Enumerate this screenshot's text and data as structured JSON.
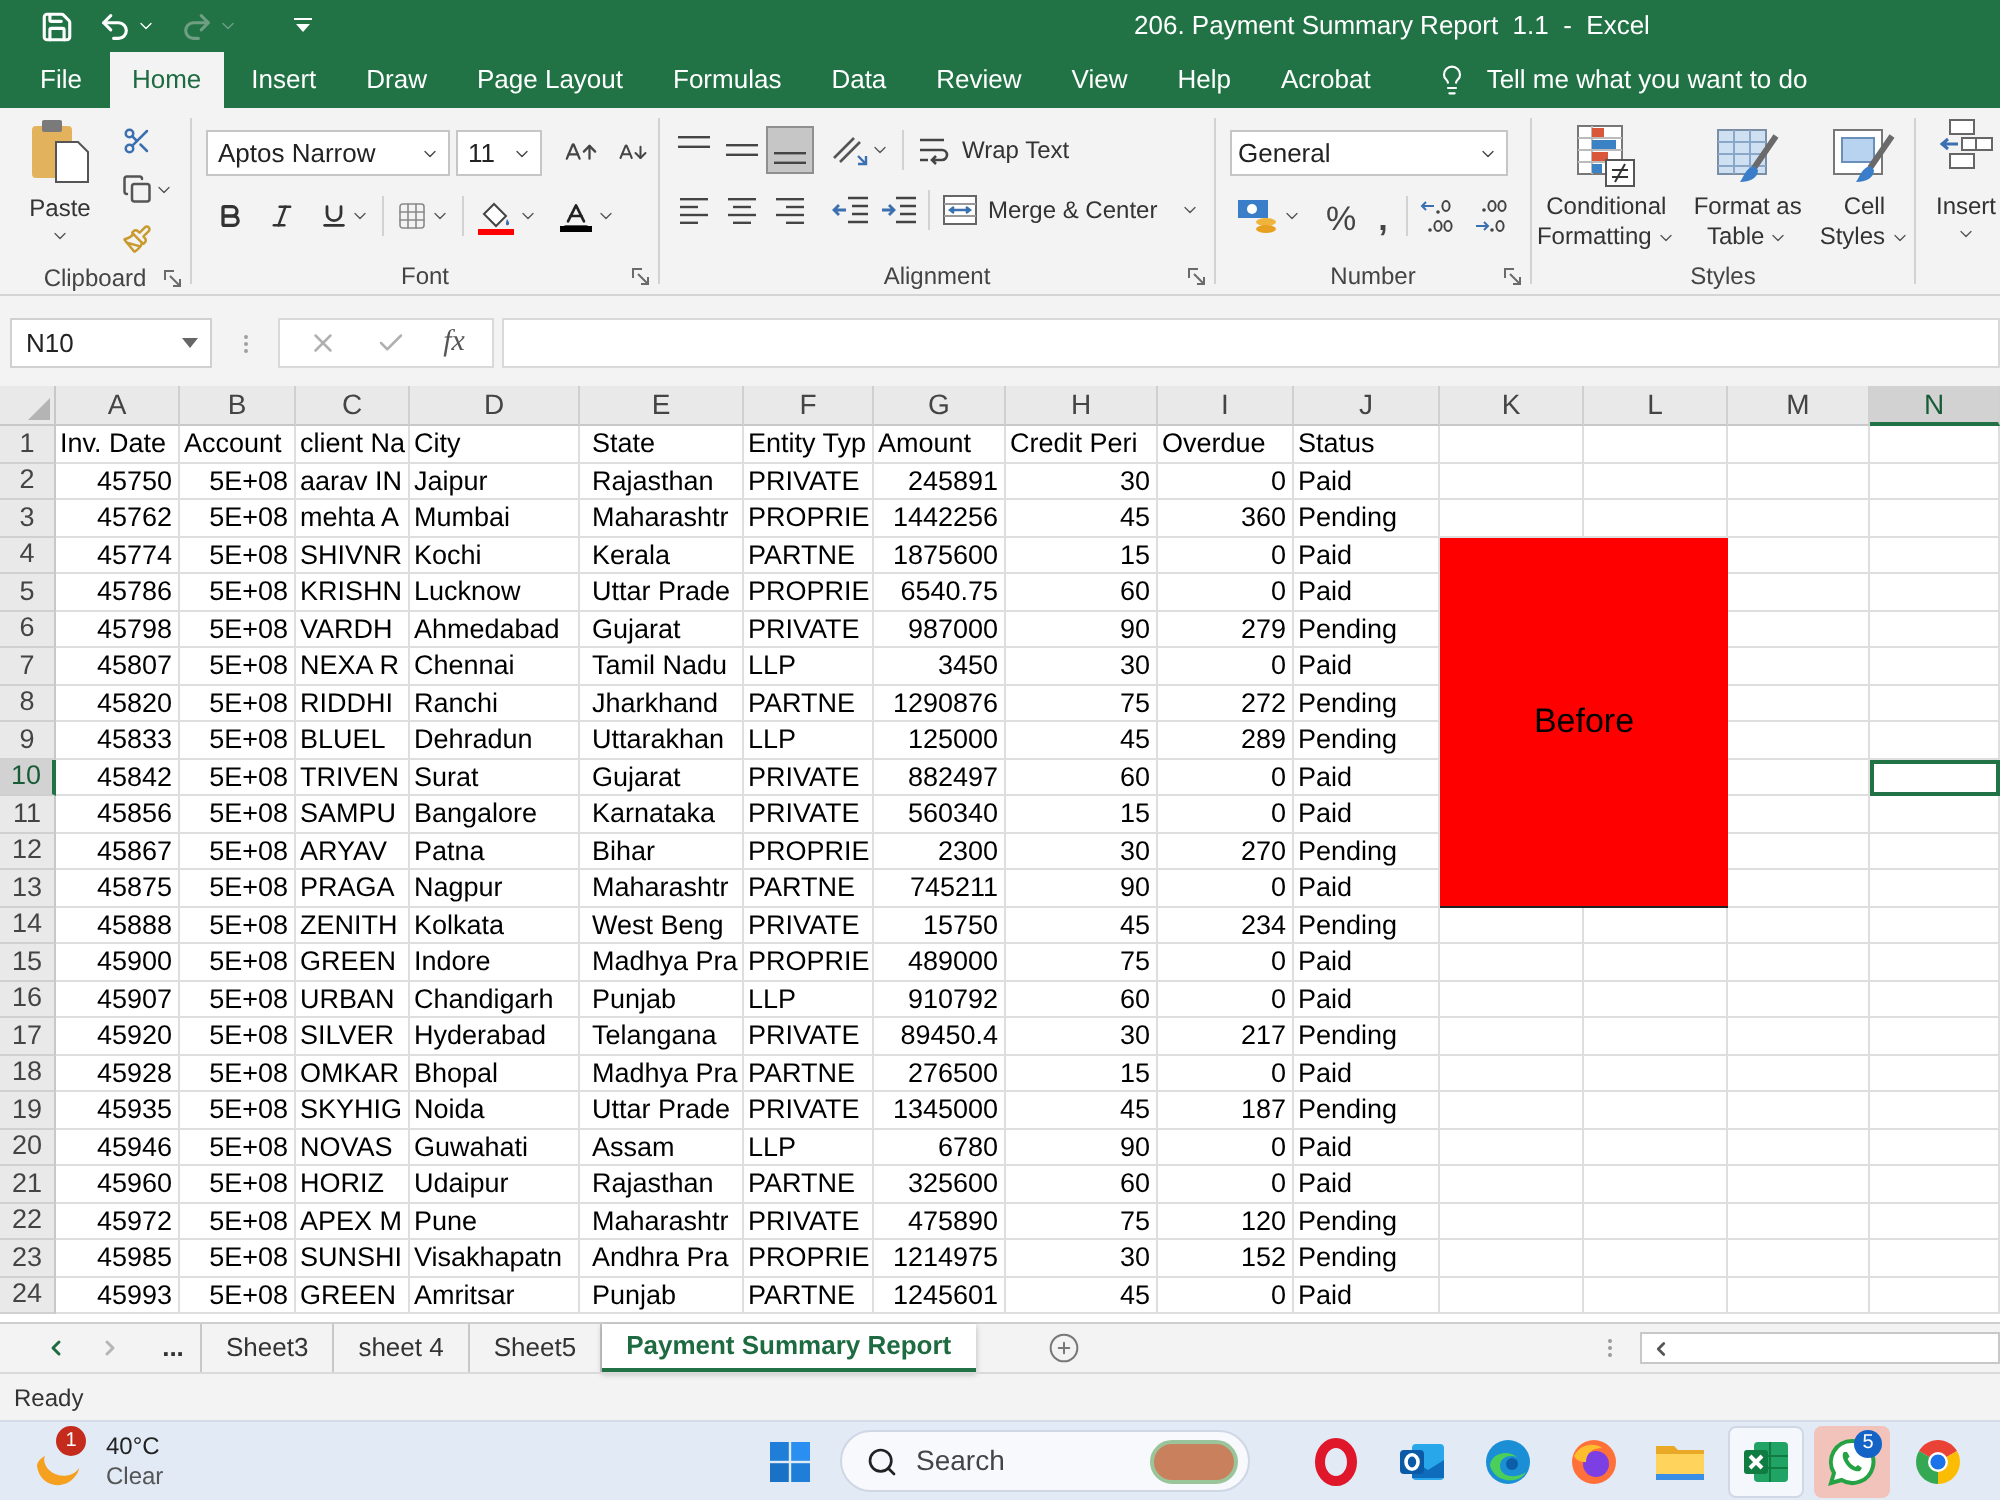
{
  "title_bar": {
    "title": "206. Payment Summary Report  1.1  -  Excel",
    "quick_access": [
      {
        "kind": "save",
        "disabled": false
      },
      {
        "kind": "undo",
        "disabled": false
      },
      {
        "kind": "redo",
        "disabled": true
      },
      {
        "kind": "customize",
        "disabled": false
      }
    ]
  },
  "ribbon_tabs": [
    {
      "label": "File",
      "selected": false
    },
    {
      "label": "Home",
      "selected": true
    },
    {
      "label": "Insert",
      "selected": false
    },
    {
      "label": "Draw",
      "selected": false
    },
    {
      "label": "Page Layout",
      "selected": false
    },
    {
      "label": "Formulas",
      "selected": false
    },
    {
      "label": "Data",
      "selected": false
    },
    {
      "label": "Review",
      "selected": false
    },
    {
      "label": "View",
      "selected": false
    },
    {
      "label": "Help",
      "selected": false
    },
    {
      "label": "Acrobat",
      "selected": false
    }
  ],
  "tell_me": {
    "placeholder": "Tell me what you want to do"
  },
  "ribbon": {
    "clipboard": {
      "label": "Clipboard",
      "paste": "Paste"
    },
    "font": {
      "label": "Font",
      "font_name": "Aptos Narrow",
      "font_size": "11"
    },
    "alignment": {
      "label": "Alignment",
      "vertical": [
        {
          "kind": "top",
          "selected": false
        },
        {
          "kind": "middle",
          "selected": false
        },
        {
          "kind": "bottom",
          "selected": true
        }
      ],
      "horizontal": [
        {
          "kind": "left",
          "selected": false
        },
        {
          "kind": "center",
          "selected": false
        },
        {
          "kind": "right",
          "selected": false
        }
      ],
      "wrap_text": "Wrap Text",
      "merge_center": "Merge & Center"
    },
    "number": {
      "label": "Number",
      "format": "General",
      "percent": "%",
      "comma": ","
    },
    "styles": {
      "label": "Styles",
      "buttons": [
        {
          "kind": "conditional",
          "lines": [
            "Conditional",
            "Formatting"
          ]
        },
        {
          "kind": "table",
          "lines": [
            "Format as",
            "Table"
          ]
        },
        {
          "kind": "cell_styles",
          "lines": [
            "Cell",
            "Styles"
          ]
        }
      ]
    },
    "cells": {
      "insert": "Insert"
    }
  },
  "formula_bar": {
    "name_box": "N10",
    "function_symbol": "fx"
  },
  "sheet": {
    "columns": [
      {
        "label": "A",
        "selected": false
      },
      {
        "label": "B",
        "selected": false
      },
      {
        "label": "C",
        "selected": false
      },
      {
        "label": "D",
        "selected": false
      },
      {
        "label": "E",
        "selected": false
      },
      {
        "label": "F",
        "selected": false
      },
      {
        "label": "G",
        "selected": false
      },
      {
        "label": "H",
        "selected": false
      },
      {
        "label": "I",
        "selected": false
      },
      {
        "label": "J",
        "selected": false
      },
      {
        "label": "K",
        "selected": false
      },
      {
        "label": "L",
        "selected": false
      },
      {
        "label": "M",
        "selected": false
      },
      {
        "label": "N",
        "selected": true
      }
    ],
    "rows": [
      {
        "number": "1",
        "selected": false,
        "cells": [
          "Inv. Date",
          "Account",
          "client Na",
          "City",
          "State",
          "Entity Typ",
          "Amount",
          "Credit Peri",
          "Overdue",
          "Status"
        ]
      },
      {
        "number": "2",
        "selected": false,
        "cells": [
          "45750",
          "5E+08",
          "aarav IN",
          "Jaipur",
          "Rajasthan",
          "PRIVATE",
          "245891",
          "30",
          "0",
          "Paid"
        ]
      },
      {
        "number": "3",
        "selected": false,
        "cells": [
          "45762",
          "5E+08",
          "mehta A",
          "Mumbai",
          "Maharashtr",
          "PROPRIE",
          "1442256",
          "45",
          "360",
          "Pending"
        ]
      },
      {
        "number": "4",
        "selected": false,
        "cells": [
          "45774",
          "5E+08",
          "SHIVNR",
          "Kochi",
          "Kerala",
          "PARTNE",
          "1875600",
          "15",
          "0",
          "Paid"
        ]
      },
      {
        "number": "5",
        "selected": false,
        "cells": [
          "45786",
          "5E+08",
          "KRISHN",
          "Lucknow",
          "Uttar Prade",
          "PROPRIE",
          "6540.75",
          "60",
          "0",
          "Paid"
        ]
      },
      {
        "number": "6",
        "selected": false,
        "cells": [
          "45798",
          "5E+08",
          "VARDH",
          "Ahmedabad",
          "Gujarat",
          "PRIVATE",
          "987000",
          "90",
          "279",
          "Pending"
        ]
      },
      {
        "number": "7",
        "selected": false,
        "cells": [
          "45807",
          "5E+08",
          "NEXA R",
          "Chennai",
          "Tamil Nadu",
          "LLP",
          "3450",
          "30",
          "0",
          "Paid"
        ]
      },
      {
        "number": "8",
        "selected": false,
        "cells": [
          "45820",
          "5E+08",
          "RIDDHI",
          "Ranchi",
          "Jharkhand",
          "PARTNE",
          "1290876",
          "75",
          "272",
          "Pending"
        ]
      },
      {
        "number": "9",
        "selected": false,
        "cells": [
          "45833",
          "5E+08",
          "BLUEL",
          "Dehradun",
          "Uttarakhan",
          "LLP",
          "125000",
          "45",
          "289",
          "Pending"
        ]
      },
      {
        "number": "10",
        "selected": true,
        "cells": [
          "45842",
          "5E+08",
          "TRIVEN",
          "Surat",
          "Gujarat",
          "PRIVATE",
          "882497",
          "60",
          "0",
          "Paid"
        ]
      },
      {
        "number": "11",
        "selected": false,
        "cells": [
          "45856",
          "5E+08",
          "SAMPU",
          "Bangalore",
          "Karnataka",
          "PRIVATE",
          "560340",
          "15",
          "0",
          "Paid"
        ]
      },
      {
        "number": "12",
        "selected": false,
        "cells": [
          "45867",
          "5E+08",
          "ARYAV",
          "Patna",
          "Bihar",
          "PROPRIE",
          "2300",
          "30",
          "270",
          "Pending"
        ]
      },
      {
        "number": "13",
        "selected": false,
        "cells": [
          "45875",
          "5E+08",
          "PRAGA",
          "Nagpur",
          "Maharashtr",
          "PARTNE",
          "745211",
          "90",
          "0",
          "Paid"
        ]
      },
      {
        "number": "14",
        "selected": false,
        "cells": [
          "45888",
          "5E+08",
          "ZENITH",
          "Kolkata",
          "West Beng",
          "PRIVATE",
          "15750",
          "45",
          "234",
          "Pending"
        ]
      },
      {
        "number": "15",
        "selected": false,
        "cells": [
          "45900",
          "5E+08",
          "GREEN",
          "Indore",
          "Madhya Pra",
          "PROPRIE",
          "489000",
          "75",
          "0",
          "Paid"
        ]
      },
      {
        "number": "16",
        "selected": false,
        "cells": [
          "45907",
          "5E+08",
          "URBAN",
          "Chandigarh",
          "Punjab",
          "LLP",
          "910792",
          "60",
          "0",
          "Paid"
        ]
      },
      {
        "number": "17",
        "selected": false,
        "cells": [
          "45920",
          "5E+08",
          "SILVER",
          "Hyderabad",
          "Telangana",
          "PRIVATE",
          "89450.4",
          "30",
          "217",
          "Pending"
        ]
      },
      {
        "number": "18",
        "selected": false,
        "cells": [
          "45928",
          "5E+08",
          "OMKAR",
          "Bhopal",
          "Madhya Pra",
          "PARTNE",
          "276500",
          "15",
          "0",
          "Paid"
        ]
      },
      {
        "number": "19",
        "selected": false,
        "cells": [
          "45935",
          "5E+08",
          "SKYHIG",
          "Noida",
          "Uttar Prade",
          "PRIVATE",
          "1345000",
          "45",
          "187",
          "Pending"
        ]
      },
      {
        "number": "20",
        "selected": false,
        "cells": [
          "45946",
          "5E+08",
          "NOVAS",
          "Guwahati",
          "Assam",
          "LLP",
          "6780",
          "90",
          "0",
          "Paid"
        ]
      },
      {
        "number": "21",
        "selected": false,
        "cells": [
          "45960",
          "5E+08",
          "HORIZ",
          "Udaipur",
          "Rajasthan",
          "PARTNE",
          "325600",
          "60",
          "0",
          "Paid"
        ]
      },
      {
        "number": "22",
        "selected": false,
        "cells": [
          "45972",
          "5E+08",
          "APEX M",
          "Pune",
          "Maharashtr",
          "PRIVATE",
          "475890",
          "75",
          "120",
          "Pending"
        ]
      },
      {
        "number": "23",
        "selected": false,
        "cells": [
          "45985",
          "5E+08",
          "SUNSHI",
          "Visakhapatn",
          "Andhra Pra",
          "PROPRIE",
          "1214975",
          "30",
          "152",
          "Pending"
        ]
      },
      {
        "number": "24",
        "selected": false,
        "cells": [
          "45993",
          "5E+08",
          "GREEN",
          "Amritsar",
          "Punjab",
          "PARTNE",
          "1245601",
          "45",
          "0",
          "Paid"
        ]
      }
    ],
    "shape": {
      "text": "Before"
    }
  },
  "sheet_tabs": {
    "overflow": "...",
    "tabs": [
      {
        "label": "Sheet3",
        "selected": false
      },
      {
        "label": "sheet 4",
        "selected": false
      },
      {
        "label": "Sheet5",
        "selected": false
      },
      {
        "label": "Payment Summary Report",
        "selected": true
      }
    ]
  },
  "status_bar": {
    "status": "Ready"
  },
  "taskbar": {
    "weather": {
      "badge": "1",
      "temperature": "40°C",
      "condition": "Clear"
    },
    "search": {
      "placeholder": "Search"
    },
    "apps": [
      {
        "kind": "opera",
        "active": false,
        "attention": false
      },
      {
        "kind": "outlook",
        "active": false,
        "attention": false
      },
      {
        "kind": "edge",
        "active": false,
        "attention": false
      },
      {
        "kind": "firefox",
        "active": false,
        "attention": false
      },
      {
        "kind": "files",
        "active": false,
        "attention": false
      },
      {
        "kind": "excel",
        "active": true,
        "attention": false
      },
      {
        "kind": "whatsapp",
        "active": false,
        "attention": true,
        "badge": "5"
      },
      {
        "kind": "chrome",
        "active": false,
        "attention": false
      }
    ]
  }
}
